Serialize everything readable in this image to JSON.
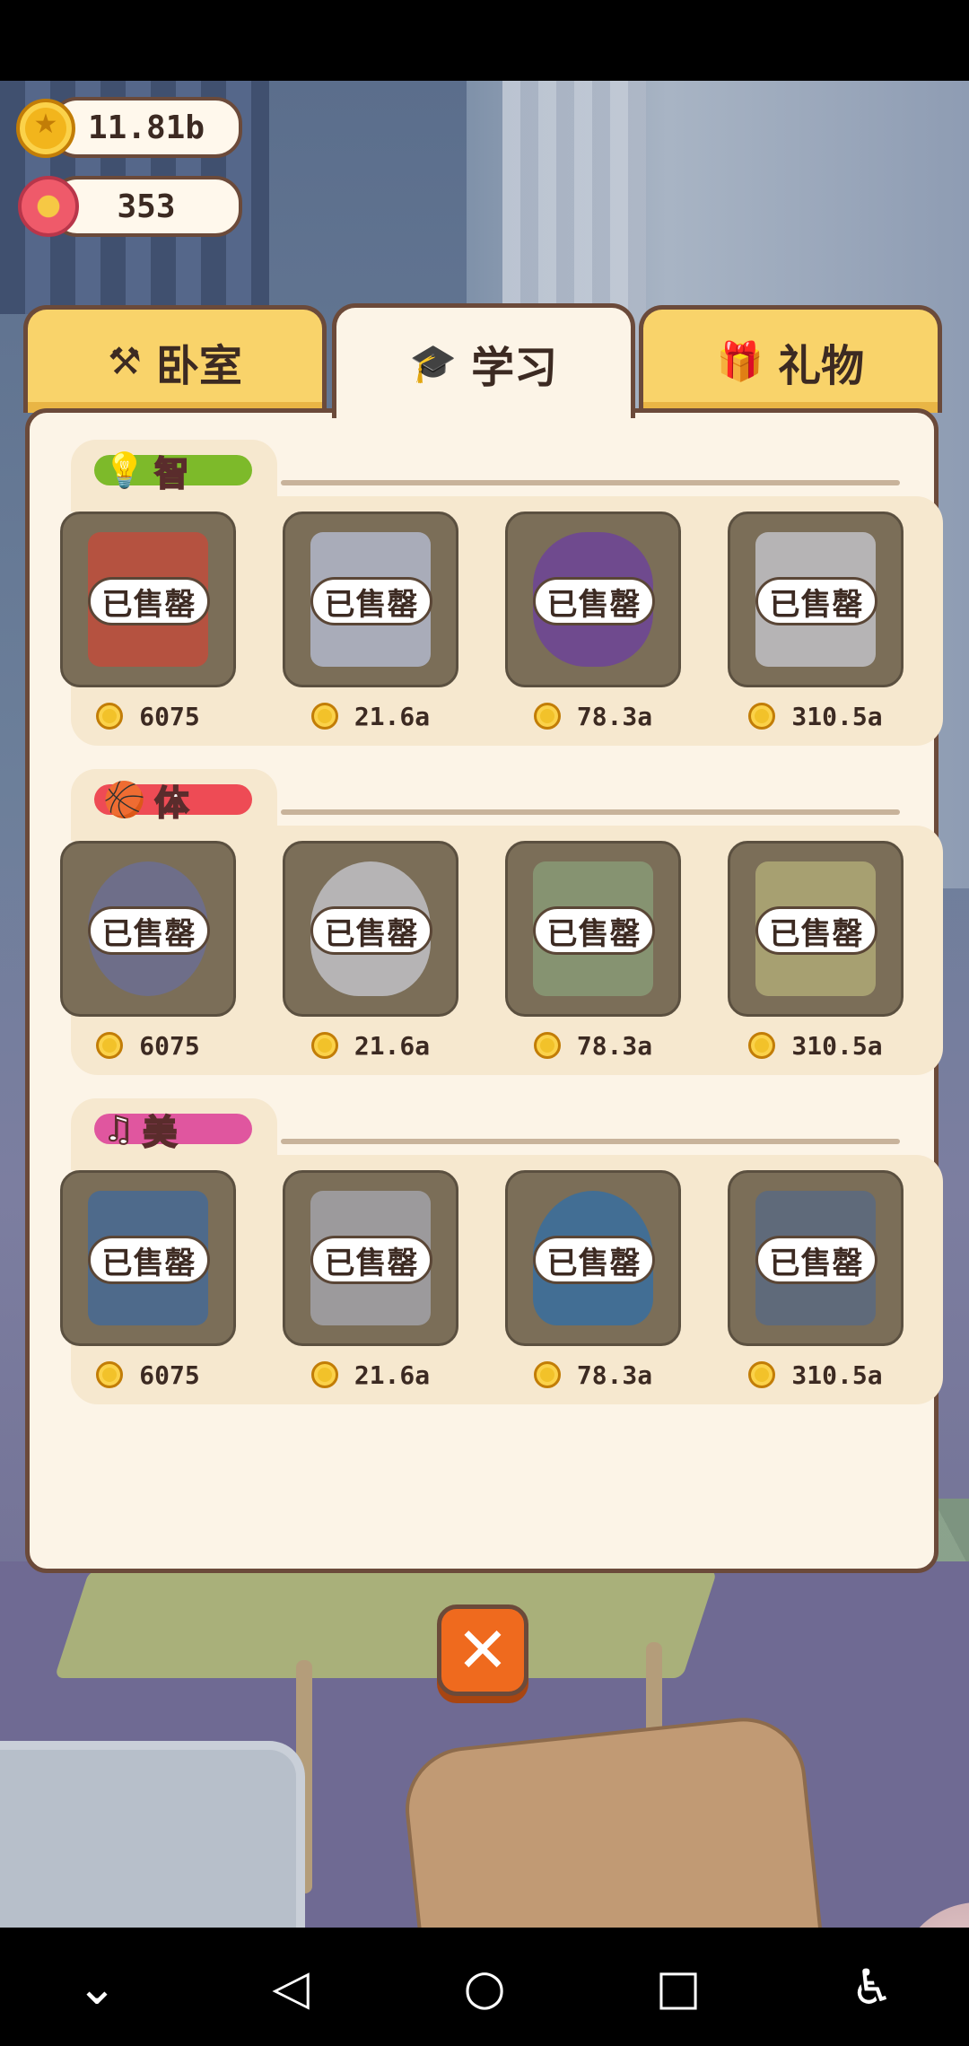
{
  "resources": {
    "coins": "11.81b",
    "flowers": "353"
  },
  "tabs": [
    {
      "label": "卧室",
      "icon": "hammer-icon",
      "active": false
    },
    {
      "label": "学习",
      "icon": "graduation-cap-icon",
      "active": true
    },
    {
      "label": "礼物",
      "icon": "gift-icon",
      "active": false
    }
  ],
  "sections": [
    {
      "label": "智",
      "icon": "lightbulb-icon",
      "color": "#7dba2a",
      "items": [
        {
          "name": "book",
          "status": "已售罄",
          "price": "6075"
        },
        {
          "name": "poster",
          "status": "已售罄",
          "price": "21.6a"
        },
        {
          "name": "purple-doll",
          "status": "已售罄",
          "price": "78.3a"
        },
        {
          "name": "paint-can",
          "status": "已售罄",
          "price": "310.5a"
        }
      ]
    },
    {
      "label": "体",
      "icon": "basketball-icon",
      "color": "#ee4b55",
      "items": [
        {
          "name": "ball",
          "status": "已售罄",
          "price": "6075"
        },
        {
          "name": "cat-bowl",
          "status": "已售罄",
          "price": "21.6a"
        },
        {
          "name": "mat",
          "status": "已售罄",
          "price": "78.3a"
        },
        {
          "name": "tent",
          "status": "已售罄",
          "price": "310.5a"
        }
      ]
    },
    {
      "label": "美",
      "icon": "music-note-icon",
      "color": "#e0569f",
      "items": [
        {
          "name": "blue-book",
          "status": "已售罄",
          "price": "6075"
        },
        {
          "name": "tray",
          "status": "已售罄",
          "price": "21.6a"
        },
        {
          "name": "vase",
          "status": "已售罄",
          "price": "78.3a"
        },
        {
          "name": "stroller",
          "status": "已售罄",
          "price": "310.5a"
        }
      ]
    }
  ],
  "close_button": {
    "icon": "close-icon",
    "symbol": "✕"
  },
  "nav": {
    "collapse": "⌄",
    "back": "◁",
    "home": "○",
    "recents": "□",
    "accessibility": "♿"
  }
}
